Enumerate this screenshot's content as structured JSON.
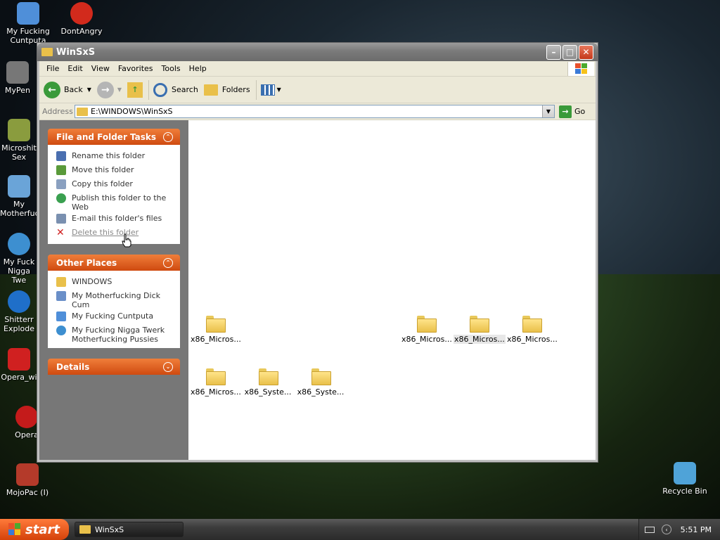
{
  "desktop": {
    "icons": [
      {
        "label": "My Fucking\nCuntputa",
        "color": "#4f8fd9"
      },
      {
        "label": "DontAngry",
        "color": "#d22a1c"
      },
      {
        "label": "MyPen",
        "color": "#777777"
      },
      {
        "label": "Microshit\nSex",
        "color": "#8a9c3e"
      },
      {
        "label": "My\nMotherfuc",
        "color": "#6aa4d8"
      },
      {
        "label": "My Fuck\nNigga Twe",
        "color": "#3d8fd0"
      },
      {
        "label": "Shitterr\nExplode",
        "color": "#1f6fc9"
      },
      {
        "label": "Opera_wi",
        "color": "#d02020"
      },
      {
        "label": "Opera",
        "color": "#c41b1b"
      },
      {
        "label": "MojoPac (I)",
        "color": "#b43a2a"
      },
      {
        "label": "Recycle Bin",
        "color": "#4fa3d8"
      }
    ]
  },
  "window": {
    "title": "WinSxS",
    "menu": [
      "File",
      "Edit",
      "View",
      "Favorites",
      "Tools",
      "Help"
    ],
    "toolbar": {
      "back": "Back",
      "search": "Search",
      "folders": "Folders"
    },
    "address": {
      "label": "Address",
      "value": "E:\\WINDOWS\\WinSxS",
      "go": "Go"
    }
  },
  "tasks": {
    "title": "File and Folder Tasks",
    "items": [
      {
        "label": "Rename this folder",
        "icon": "rename-icon",
        "color": "#4a6fb0"
      },
      {
        "label": "Move this folder",
        "icon": "move-icon",
        "color": "#5a9a3a"
      },
      {
        "label": "Copy this folder",
        "icon": "copy-icon",
        "color": "#8aa0c0"
      },
      {
        "label": "Publish this folder to the Web",
        "icon": "globe-icon",
        "color": "#3aa050"
      },
      {
        "label": "E-mail this folder's files",
        "icon": "email-icon",
        "color": "#7a90b0"
      },
      {
        "label": "Delete this folder",
        "icon": "delete-icon",
        "color": "#d02020"
      }
    ]
  },
  "places": {
    "title": "Other Places",
    "items": [
      {
        "label": "WINDOWS",
        "icon": "folder-icon",
        "color": "#e9c04a"
      },
      {
        "label": "My Motherfucking Dick Cum",
        "icon": "documents-icon",
        "color": "#6a8fc8"
      },
      {
        "label": "My Fucking Cuntputa",
        "icon": "computer-icon",
        "color": "#4f8fd9"
      },
      {
        "label": "My Fucking Nigga Twerk Motherfucking Pussies",
        "icon": "network-icon",
        "color": "#3d8fd0"
      }
    ]
  },
  "details": {
    "title": "Details"
  },
  "files": [
    {
      "name": "x86_Micros...",
      "selected": false
    },
    {
      "name": "x86_Micros...",
      "selected": false
    },
    {
      "name": "x86_Micros...",
      "selected": true
    },
    {
      "name": "x86_Micros...",
      "selected": false
    },
    {
      "name": "x86_Micros...",
      "selected": false
    },
    {
      "name": "x86_Syste...",
      "selected": false
    },
    {
      "name": "x86_Syste...",
      "selected": false
    }
  ],
  "taskbar": {
    "start": "start",
    "window_button": "WinSxS",
    "clock": "5:51 PM"
  },
  "colors": {
    "accent": "#e05a1c",
    "taskpane_bg": "#777777",
    "folder": "#e9c04a"
  }
}
